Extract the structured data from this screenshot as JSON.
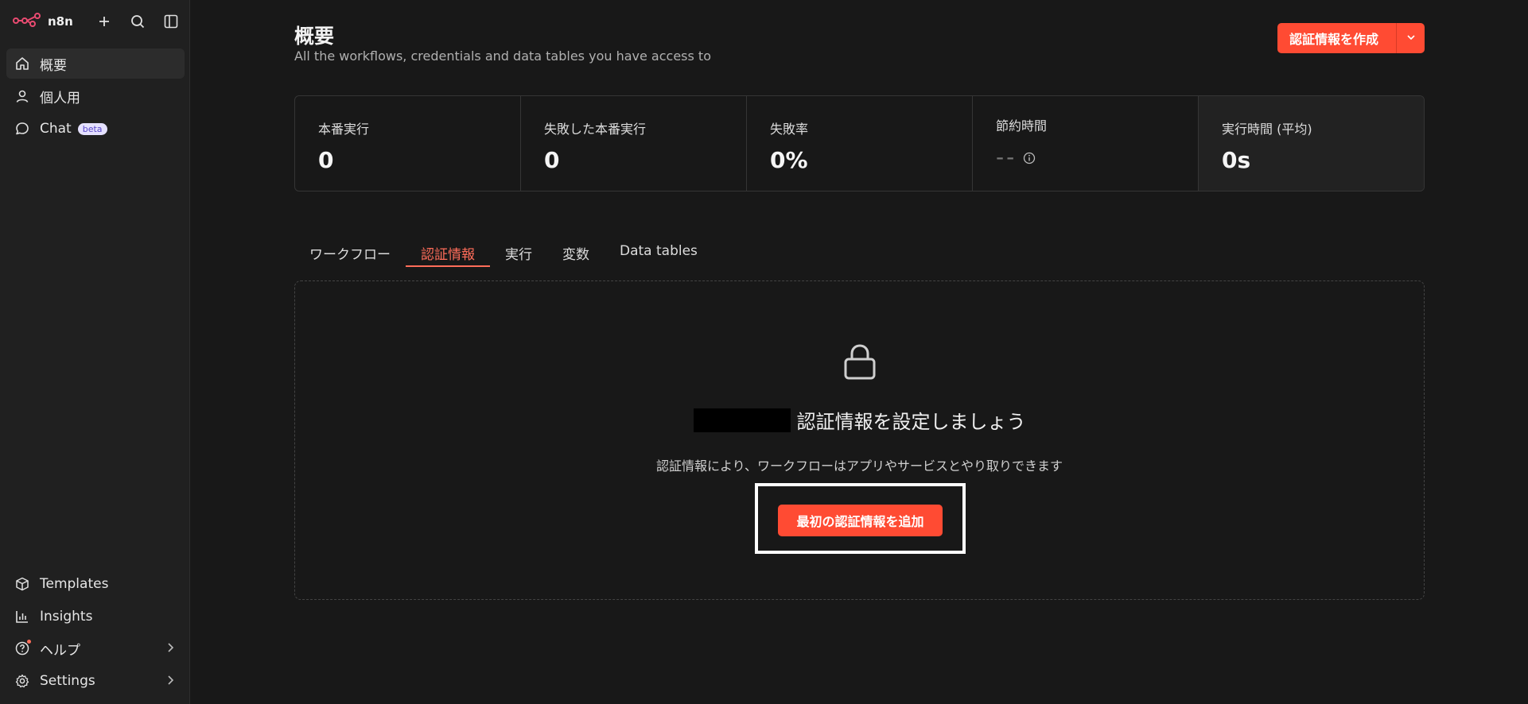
{
  "app": {
    "name": "n8n"
  },
  "sidebar": {
    "items": [
      {
        "label": "概要",
        "icon": "home-icon"
      },
      {
        "label": "個人用",
        "icon": "user-icon"
      },
      {
        "label": "Chat",
        "icon": "chat-icon",
        "badge": "beta"
      }
    ],
    "bottom_items": [
      {
        "label": "Templates",
        "icon": "templates-icon"
      },
      {
        "label": "Insights",
        "icon": "insights-icon"
      },
      {
        "label": "ヘルプ",
        "icon": "help-icon"
      },
      {
        "label": "Settings",
        "icon": "gear-icon"
      }
    ]
  },
  "header": {
    "title": "概要",
    "subtitle": "All the workflows, credentials and data tables you have access to",
    "create_button": "認証情報を作成"
  },
  "stats": [
    {
      "label": "本番実行",
      "value": "0"
    },
    {
      "label": "失敗した本番実行",
      "value": "0"
    },
    {
      "label": "失敗率",
      "value": "0%"
    },
    {
      "label": "節約時間",
      "value": "--"
    },
    {
      "label": "実行時間 (平均)",
      "value": "0s"
    }
  ],
  "tabs": [
    "ワークフロー",
    "認証情報",
    "実行",
    "変数",
    "Data tables"
  ],
  "active_tab": "認証情報",
  "empty_state": {
    "heading": "認証情報を設定しましょう",
    "description": "認証情報により、ワークフローはアプリやサービスとやり取りできます",
    "button": "最初の認証情報を追加"
  },
  "colors": {
    "accent": "#ff4b33",
    "tab_active": "#ff6d5a",
    "background": "#181818",
    "sidebar": "#202020"
  }
}
